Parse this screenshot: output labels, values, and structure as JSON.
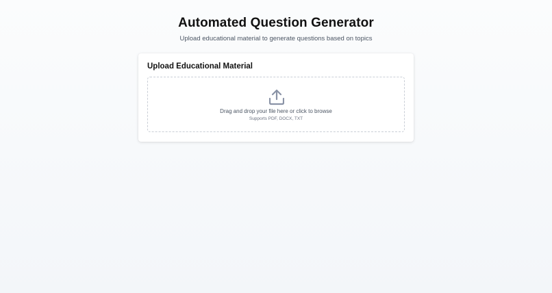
{
  "header": {
    "title": "Automated Question Generator",
    "subtitle": "Upload educational material to generate questions based on topics"
  },
  "upload_card": {
    "title": "Upload Educational Material",
    "dropzone": {
      "icon": "upload-icon",
      "instruction": "Drag and drop your file here or click to browse",
      "supported_formats": "Supports PDF, DOCX, TXT"
    }
  },
  "colors": {
    "background": "#f5f7fa",
    "card": "#ffffff",
    "icon": "#8a93a6",
    "dashed_border": "#c9ced6",
    "subtitle_text": "#4b5563"
  }
}
